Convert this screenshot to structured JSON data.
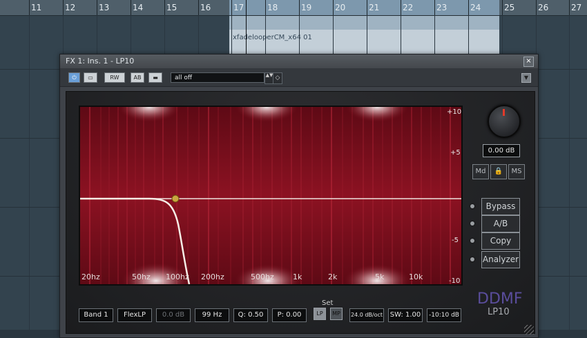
{
  "timeline": {
    "bar_numbers": [
      "11",
      "12",
      "13",
      "14",
      "15",
      "16",
      "17",
      "18",
      "19",
      "20",
      "21",
      "22",
      "23",
      "24",
      "25",
      "26",
      "27"
    ],
    "clip_name": "xfadelooperCM_x64 01"
  },
  "plugin": {
    "title": "FX 1: Ins. 1 - LP10",
    "close_glyph": "×",
    "toolbar": {
      "power_glyph": "⏻",
      "bypass_glyph": "▭",
      "rw_label": "RW",
      "ab_label": "AB",
      "settings_glyph": "▬",
      "preset_name": "all off",
      "arrows_glyph": "▲▼",
      "fav_glyph": "◇",
      "dropdown_glyph": "▼"
    },
    "graph": {
      "freq_labels": [
        "20hz",
        "50hz",
        "100hz",
        "200hz",
        "500hz",
        "1k",
        "2k",
        "5k",
        "10k"
      ],
      "db_labels": [
        "+10",
        "+5",
        "-5",
        "-10"
      ]
    },
    "side": {
      "gain_readout": "0.00 dB",
      "md_label": "Md",
      "lock_glyph": "🔒",
      "ms_label": "MS",
      "bypass_label": "Bypass",
      "ab_label": "A/B",
      "copy_label": "Copy",
      "analyzer_label": "Analyzer",
      "logo_text": "DDMF",
      "product_text": "LP10"
    },
    "bottom": {
      "band": "Band 1",
      "filter_type": "FlexLP",
      "gain": "0.0 dB",
      "freq": "99 Hz",
      "q": "Q: 0.50",
      "p": "P: 0.00",
      "set_label": "Set",
      "lp_label": "LP",
      "mp_label": "MP",
      "slope": "24.0 dB/oct",
      "sw": "SW: 1.00",
      "range": "-10:10 dB"
    }
  },
  "colors": {
    "graph_bg": "#8a0f1d",
    "curve": "#f2e9e1",
    "node": "#c9a640"
  }
}
